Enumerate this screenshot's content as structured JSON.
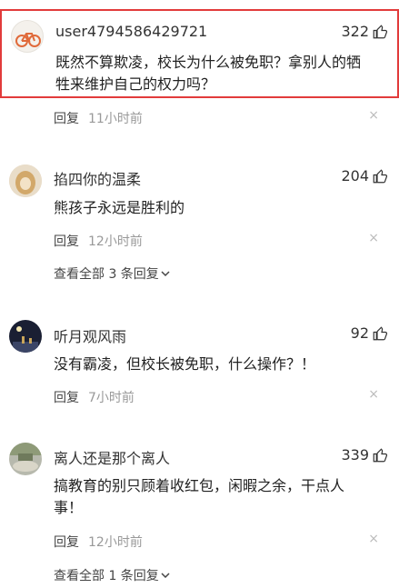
{
  "comments": [
    {
      "username": "user4794586429721",
      "likes": "322",
      "text": "既然不算欺凌，校长为什么被免职？拿别人的牺牲来维护自己的权力吗？",
      "reply": "回复",
      "time": "11小时前",
      "close": "×"
    },
    {
      "username": "掐四你的温柔",
      "likes": "204",
      "text": "熊孩子永远是胜利的",
      "reply": "回复",
      "time": "12小时前",
      "close": "×",
      "more": "查看全部 3 条回复"
    },
    {
      "username": "听月观风雨",
      "likes": "92",
      "text": "没有霸凌，但校长被免职，什么操作？！",
      "reply": "回复",
      "time": "7小时前",
      "close": "×"
    },
    {
      "username": "离人还是那个离人",
      "likes": "339",
      "text": "搞教育的别只顾着收红包，闲暇之余，干点人事！",
      "reply": "回复",
      "time": "12小时前",
      "close": "×",
      "more": "查看全部 1 条回复"
    }
  ],
  "icons": {
    "like": "thumbs-up-icon",
    "close": "close-icon",
    "more": "chevron-down-icon"
  },
  "colors": {
    "highlight_border": "#e23b3b",
    "meta_gray": "#999999"
  }
}
